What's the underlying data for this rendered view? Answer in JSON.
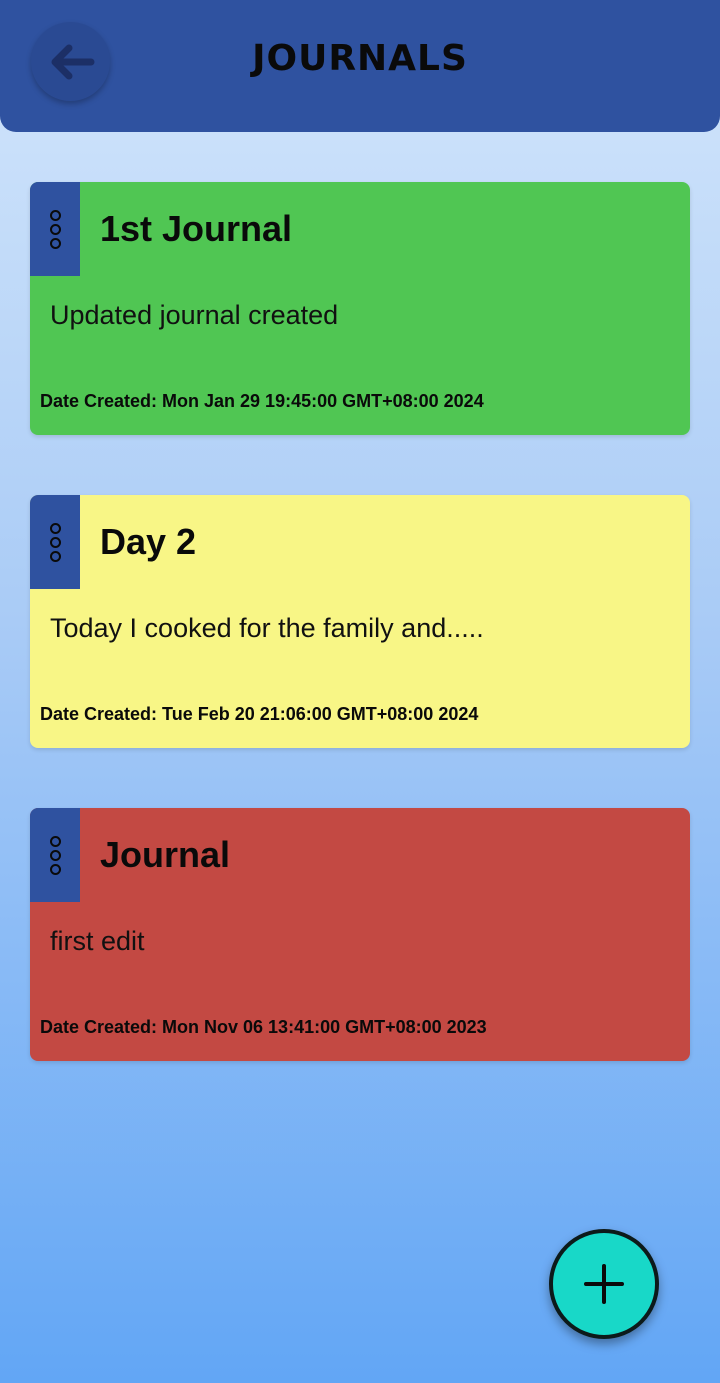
{
  "header": {
    "title": "JOURNALS",
    "back_icon": "arrow-left-icon"
  },
  "colors": {
    "header_bg": "#2f52a0",
    "fab_bg": "#18d8c8"
  },
  "journals": [
    {
      "title": "1st Journal",
      "body": "Updated journal created",
      "date": "Date Created: Mon Jan 29 19:45:00 GMT+08:00 2024",
      "color": "#50c653"
    },
    {
      "title": "Day 2",
      "body": "Today I cooked for the family and.....",
      "date": "Date Created: Tue Feb 20 21:06:00 GMT+08:00 2024",
      "color": "#f8f686"
    },
    {
      "title": "Journal",
      "body": "first edit",
      "date": "Date Created: Mon Nov 06 13:41:00 GMT+08:00 2023",
      "color": "#c34943"
    }
  ],
  "fab": {
    "icon": "plus-icon"
  }
}
